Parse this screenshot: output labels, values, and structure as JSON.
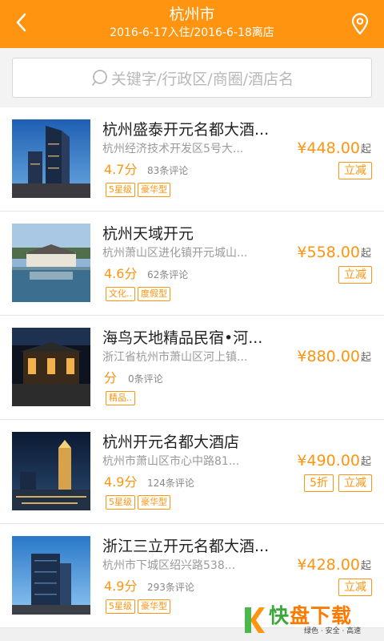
{
  "header": {
    "title": "杭州市",
    "subtitle": "2016-6-17入住/2016-6-18离店",
    "back_icon": "back-chevron-icon",
    "location_icon": "location-pin-icon"
  },
  "search": {
    "placeholder": "关键字/行政区/商圈/酒店名",
    "icon": "search-icon"
  },
  "hotels": [
    {
      "name": "杭州盛泰开元名都大酒...",
      "address": "杭州经济技术开发区5号大...",
      "score": "4.7分",
      "reviews": "83条评论",
      "tags": [
        "5星级",
        "豪华型"
      ],
      "price": "¥448.00",
      "price_suffix": "起",
      "promos": [
        "立减"
      ]
    },
    {
      "name": "杭州天域开元",
      "address": "杭州萧山区进化镇开元城山...",
      "score": "4.6分",
      "reviews": "62条评论",
      "tags": [
        "文化..",
        "度假型"
      ],
      "price": "¥558.00",
      "price_suffix": "起",
      "promos": [
        "立减"
      ]
    },
    {
      "name": "海鸟天地精品民宿•河...",
      "address": "浙江省杭州市萧山区河上镇...",
      "score": "分",
      "reviews": "0条评论",
      "tags": [
        "精品.."
      ],
      "price": "¥880.00",
      "price_suffix": "起",
      "promos": []
    },
    {
      "name": "杭州开元名都大酒店",
      "address": "杭州市萧山区市心中路81...",
      "score": "4.9分",
      "reviews": "124条评论",
      "tags": [
        "5星级",
        "豪华型"
      ],
      "price": "¥490.00",
      "price_suffix": "起",
      "promos": [
        "5折",
        "立减"
      ]
    },
    {
      "name": "浙江三立开元名都大酒...",
      "address": "杭州市下城区绍兴路538...",
      "score": "4.9分",
      "reviews": "293条评论",
      "tags": [
        "5星级",
        "豪华型"
      ],
      "price": "¥428.00",
      "price_suffix": "起",
      "promos": [
        "立减"
      ]
    }
  ],
  "watermark": {
    "brand_a": "快",
    "brand_b": "盘下载",
    "tagline": "绿色 · 安全 · 高速"
  },
  "colors": {
    "accent": "#ff9410",
    "background": "#f0f0f0"
  }
}
